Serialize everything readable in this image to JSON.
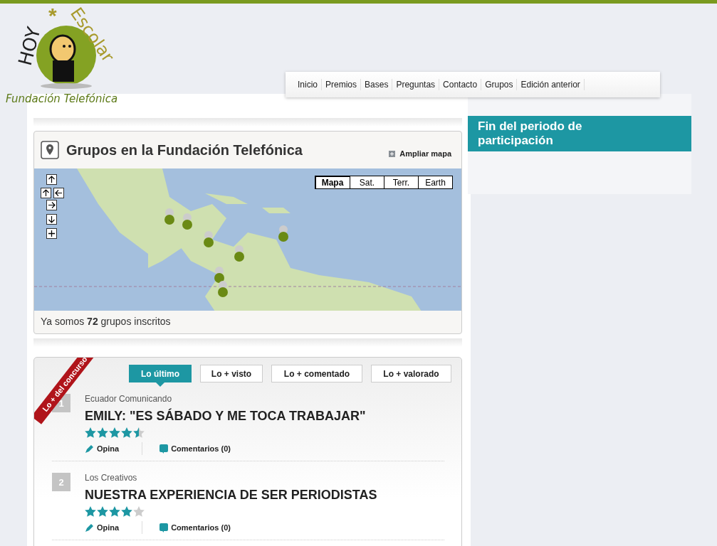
{
  "logo": {
    "word_1": "HOY",
    "star": "*",
    "word_2": "Escolar",
    "subtitle": "Fundación Telefónica"
  },
  "nav": [
    {
      "label": "Inicio"
    },
    {
      "label": "Premios"
    },
    {
      "label": "Bases"
    },
    {
      "label": "Preguntas"
    },
    {
      "label": "Contacto"
    },
    {
      "label": "Grupos"
    },
    {
      "label": "Edición anterior"
    }
  ],
  "map_card": {
    "title": "Grupos en la Fundación Telefónica",
    "expand_link": "Ampliar mapa",
    "map_types": [
      {
        "label": "Mapa",
        "selected": true
      },
      {
        "label": "Sat.",
        "selected": false
      },
      {
        "label": "Terr.",
        "selected": false
      },
      {
        "label": "Earth",
        "selected": false
      }
    ],
    "footer": "Ya somos **72** grupos inscritos"
  },
  "ranking": {
    "ribbon": "Lo + del concurso",
    "tabs": [
      {
        "label": "Lo último",
        "selected": true
      },
      {
        "label": "Lo + visto",
        "selected": false
      },
      {
        "label": "Lo + comentado",
        "selected": false
      },
      {
        "label": "Lo + valorado",
        "selected": false
      }
    ],
    "items": [
      {
        "rank": "1",
        "group": "Ecuador Comunicando",
        "title": "EMILY: \"ES SÁBADO Y ME TOCA TRABAJAR\"",
        "stars": 4.5,
        "opine": "Opina",
        "comments": "Comentarios (0)"
      },
      {
        "rank": "2",
        "group": "Los Creativos",
        "title": "NUESTRA EXPERIENCIA DE SER PERIODISTAS",
        "stars": 4,
        "opine": "Opina",
        "comments": "Comentarios (0)"
      }
    ]
  },
  "sidebar": {
    "banner": "Fin del periodo de participación"
  }
}
